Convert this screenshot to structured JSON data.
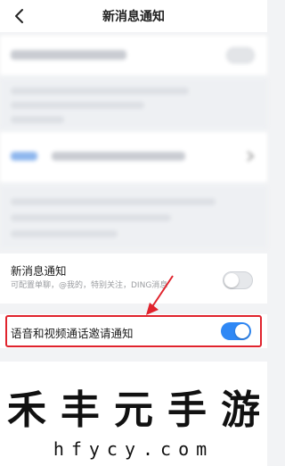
{
  "header": {
    "title": "新消息通知"
  },
  "settings": {
    "new_message": {
      "title": "新消息通知",
      "subtitle": "可配置单聊，@我的，特别关注，DING消息",
      "enabled": false
    },
    "call_invite": {
      "title": "语音和视频通话邀请通知",
      "enabled": true
    }
  },
  "colors": {
    "accent": "#2f88f5",
    "highlight": "#e0232d"
  },
  "icons": {
    "back": "chevron-left-icon",
    "chevron": "chevron-right-icon"
  },
  "watermark": {
    "chars": [
      "禾",
      "丰",
      "元",
      "手",
      "游"
    ],
    "url": "hfycy.com"
  }
}
